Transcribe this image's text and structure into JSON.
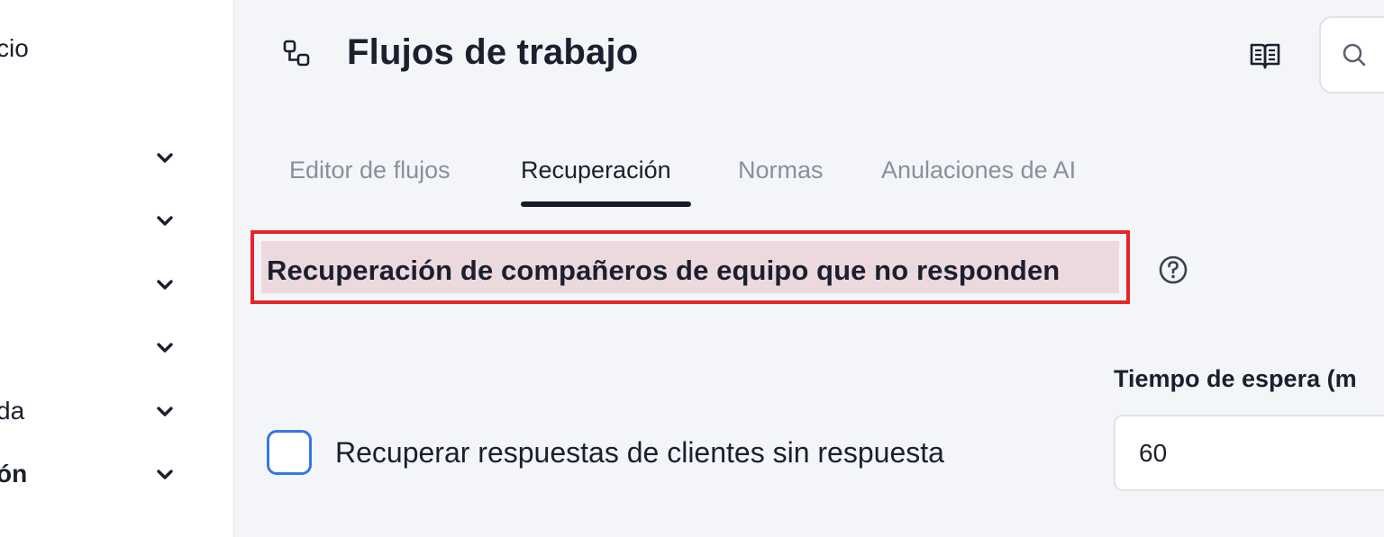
{
  "sidebar": {
    "items": [
      {
        "label": "cio",
        "bold": false,
        "has_chevron": false
      },
      {
        "label": "",
        "has_chevron": true
      },
      {
        "label": "",
        "has_chevron": true
      },
      {
        "label": "",
        "has_chevron": true
      },
      {
        "label": "",
        "has_chevron": true
      },
      {
        "label": "da",
        "bold": false,
        "has_chevron": true
      },
      {
        "label": "ón",
        "bold": true,
        "has_chevron": true
      }
    ]
  },
  "header": {
    "title": "Flujos de trabajo",
    "title_icon": "workflow-icon",
    "docs_icon": "book-icon",
    "search_icon": "search-icon"
  },
  "tabs": [
    {
      "label": "Editor de flujos",
      "active": false
    },
    {
      "label": "Recuperación",
      "active": true
    },
    {
      "label": "Normas",
      "active": false
    },
    {
      "label": "Anulaciones de AI",
      "active": false
    }
  ],
  "section": {
    "title": "Recuperación de compañeros de equipo que no responden",
    "help_icon": "help-circle-icon"
  },
  "form": {
    "checkbox_label": "Recuperar respuestas de clientes sin respuesta",
    "checkbox_checked": false,
    "timeout_label": "Tiempo de espera (m",
    "timeout_value": "60"
  },
  "colors": {
    "background": "#f4f5f8",
    "highlight_border": "#e3262b",
    "checkbox_border": "#3478e8",
    "active_tab_underline": "#151a2c",
    "inactive_tab_text": "#8a8f9c"
  }
}
